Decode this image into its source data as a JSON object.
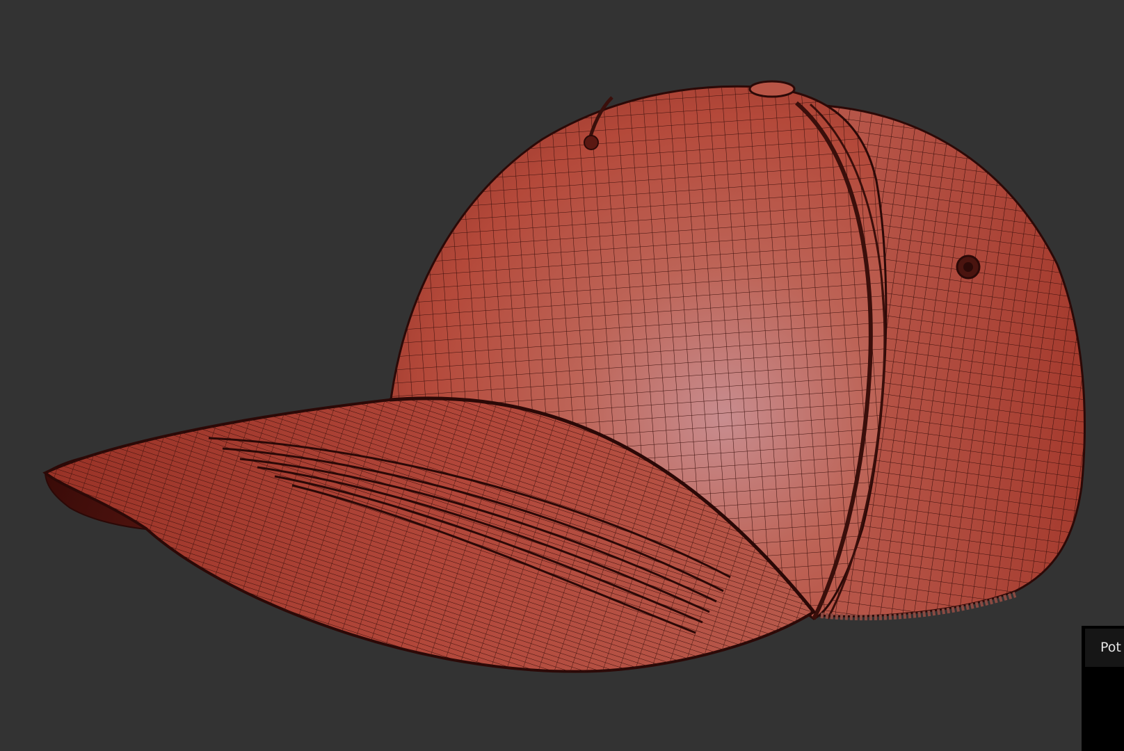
{
  "viewport": {
    "background": "#333333",
    "model": {
      "name": "baseball-cap",
      "display_mode": "wireframe-on-shaded",
      "base_color": "#b3493a",
      "wire_color": "#3a0f0b"
    }
  },
  "side_panel": {
    "background": "#000000",
    "tab_label": "Pot"
  }
}
